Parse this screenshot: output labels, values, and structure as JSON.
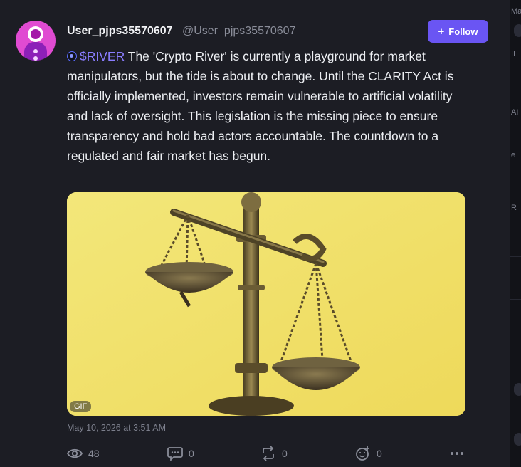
{
  "post": {
    "display_name": "User_pjps35570607",
    "handle": "@User_pjps35570607",
    "follow_label": "Follow",
    "cashtag": "$RIVER",
    "body": " The 'Crypto River' is currently a playground for market manipulators, but the tide is about to change. Until the CLARITY Act is officially implemented, investors remain vulnerable to artificial volatility and lack of oversight. This legislation is the missing piece to ensure transparency and hold bad actors accountable. The countdown to a regulated and fair market has begun.",
    "media_badge": "GIF",
    "timestamp": "May 10, 2026 at 3:51 AM",
    "stats": {
      "views": "48",
      "comments": "0",
      "reposts": "0",
      "likes": "0"
    }
  },
  "right_panel_fragments": [
    "Ma",
    "II",
    "AI",
    "e",
    "R"
  ],
  "colors": {
    "accent": "#6a55f3",
    "cashtag": "#8a7dff",
    "background": "#1c1d24",
    "media_bg": "#f0e266"
  },
  "icons": [
    "avatar",
    "plus-icon",
    "token-icon",
    "eye-icon",
    "comment-icon",
    "repost-icon",
    "like-icon",
    "more-icon"
  ]
}
